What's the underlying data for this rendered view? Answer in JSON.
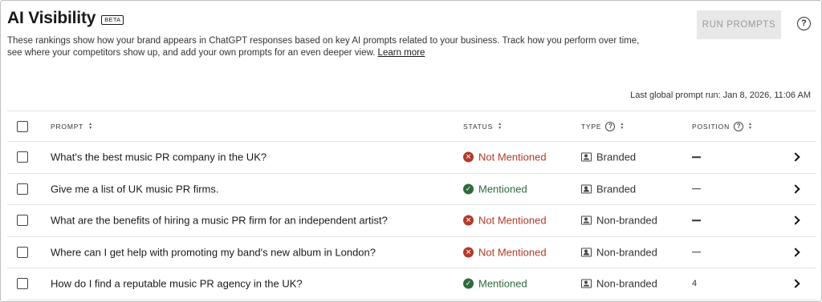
{
  "header": {
    "title": "AI Visibility",
    "badge": "BETA",
    "description": "These rankings show how your brand appears in ChatGPT responses based on key AI prompts related to your business. Track how you perform over time, see where your competitors show up, and add your own prompts for an even deeper view.",
    "learn_more": "Learn more",
    "run_button": "RUN PROMPTS",
    "help_glyph": "?"
  },
  "last_run": "Last global prompt run: Jan 8, 2026, 11:06 AM",
  "table": {
    "columns": {
      "prompt": "PROMPT",
      "status": "STATUS",
      "type": "TYPE",
      "position": "POSITION"
    },
    "rows": [
      {
        "prompt": "What's the best music PR company in the UK?",
        "status": "Not Mentioned",
        "type": "Branded",
        "position": ""
      },
      {
        "prompt": "Give me a list of UK music PR firms.",
        "status": "Mentioned",
        "type": "Branded",
        "position": ""
      },
      {
        "prompt": "What are the benefits of hiring a music PR firm for an independent artist?",
        "status": "Not Mentioned",
        "type": "Non-branded",
        "position": ""
      },
      {
        "prompt": "Where can I get help with promoting my band's new album in London?",
        "status": "Not Mentioned",
        "type": "Non-branded",
        "position": ""
      },
      {
        "prompt": "How do I find a reputable music PR agency in the UK?",
        "status": "Mentioned",
        "type": "Non-branded",
        "position": "4"
      }
    ]
  },
  "colors": {
    "not_mentioned": "#b23a2a",
    "mentioned": "#2e6b3e",
    "disabled_button_bg": "#e8e8e8"
  },
  "icons": {
    "status_not_mentioned": "x-circle-icon",
    "status_mentioned": "check-circle-icon",
    "type": "portrait-icon",
    "row_action": "chevron-right-icon",
    "sort": "sort-icon",
    "help": "question-circle-icon"
  }
}
